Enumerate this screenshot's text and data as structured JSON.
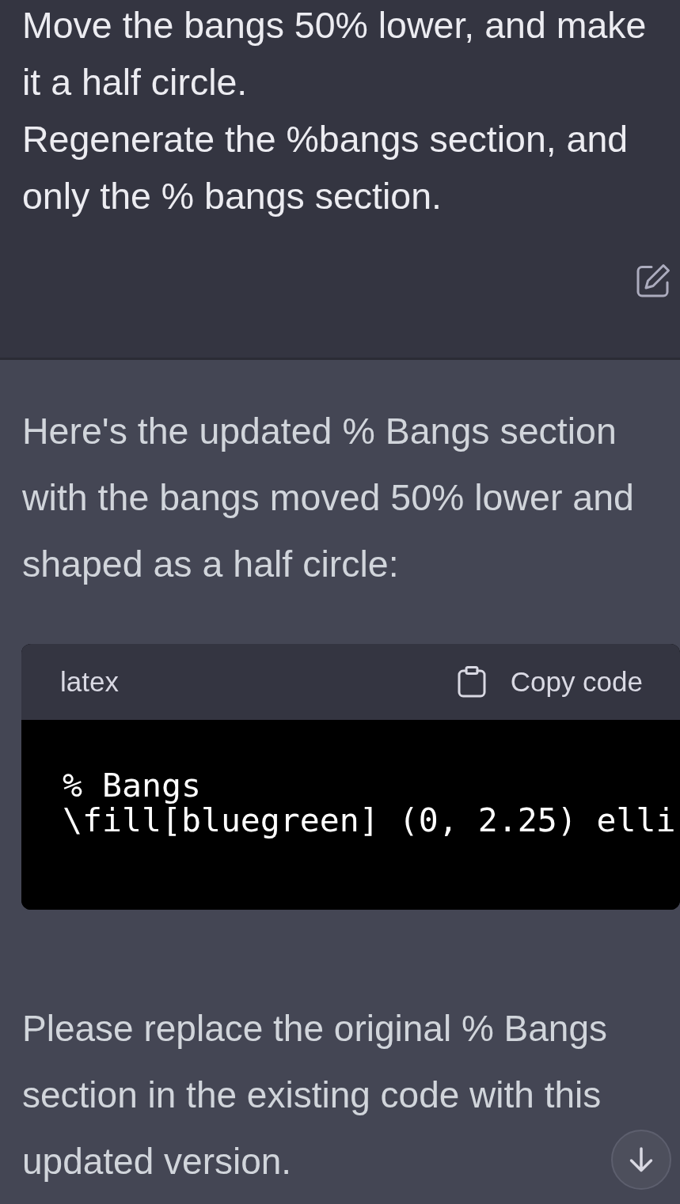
{
  "user_message": {
    "paragraphs": [
      "Move the bangs 50% lower, and make it a half circle.",
      "Regenerate the %bangs section, and only the % bangs section."
    ]
  },
  "assistant_message": {
    "intro": "Here's the updated % Bangs section with the bangs moved 50% lower and shaped as a half circle:",
    "code_block": {
      "language": "latex",
      "copy_label": "Copy code",
      "lines": [
        "% Bangs",
        "\\fill[bluegreen] (0, 2.25) elli"
      ]
    },
    "outro": "Please replace the original % Bangs section in the existing code with this updated version."
  }
}
